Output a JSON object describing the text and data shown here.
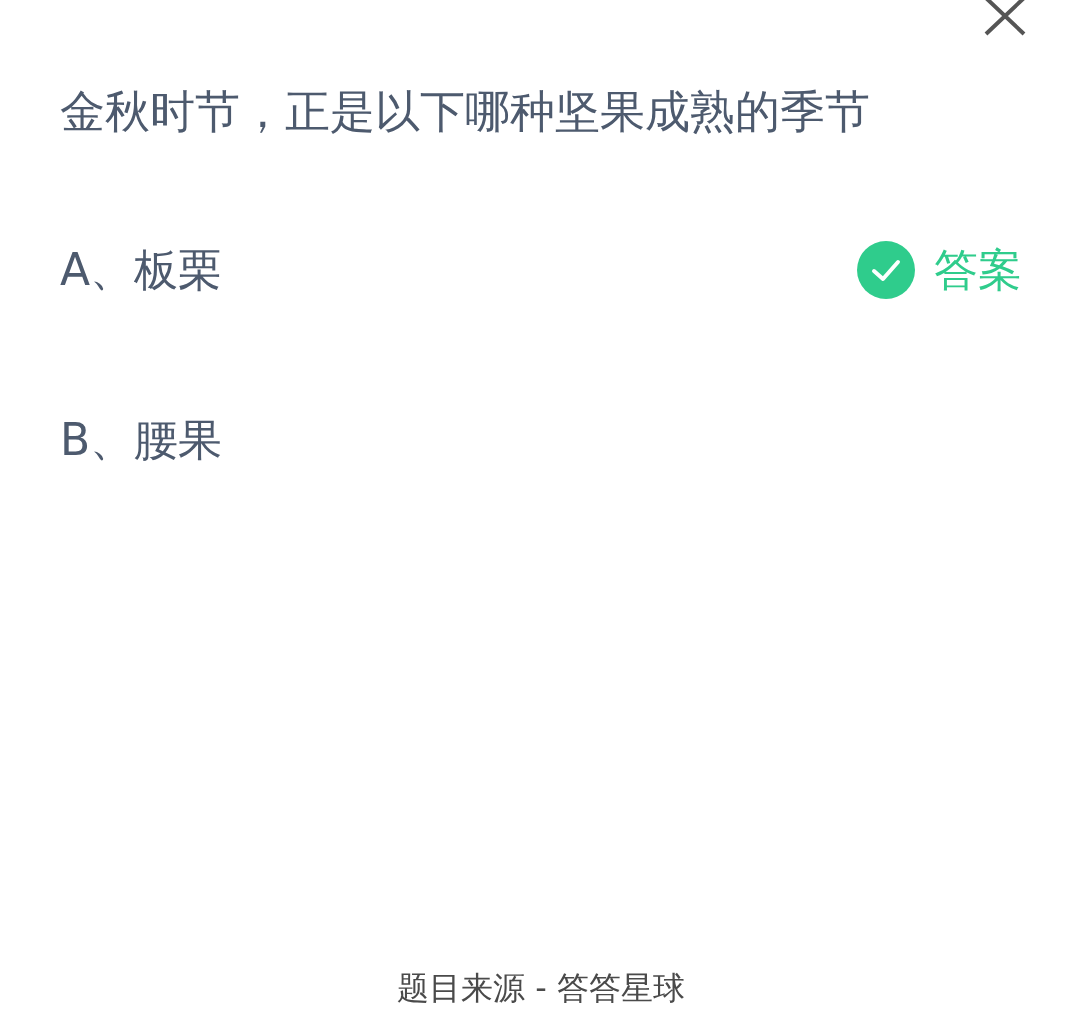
{
  "question": "金秋时节，正是以下哪种坚果成熟的季节",
  "options": [
    {
      "text": "A、板栗",
      "correct": true,
      "badge": "答案"
    },
    {
      "text": "B、腰果",
      "correct": false
    }
  ],
  "footer": "题目来源 - 答答星球"
}
